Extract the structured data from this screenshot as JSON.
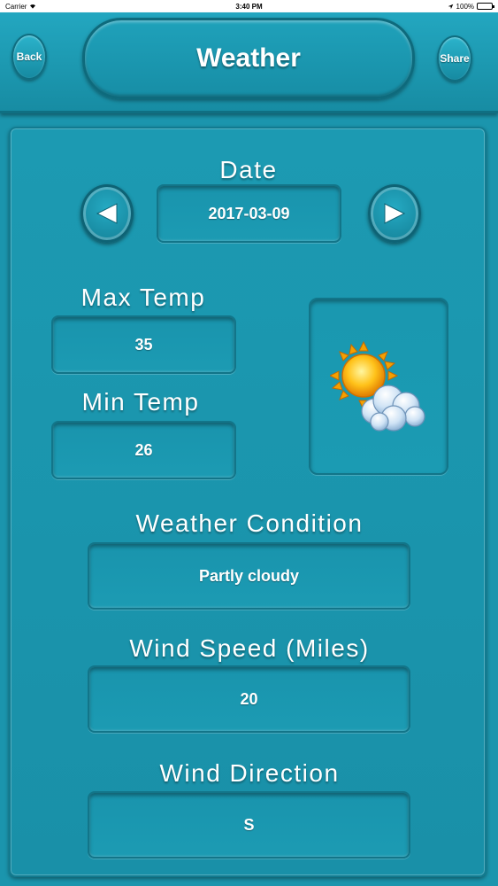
{
  "status_bar": {
    "carrier": "Carrier",
    "time": "3:40 PM",
    "battery": "100%"
  },
  "header": {
    "back_label": "Back",
    "title": "Weather",
    "share_label": "Share"
  },
  "date": {
    "label": "Date",
    "value": "2017-03-09"
  },
  "max_temp": {
    "label": "Max Temp",
    "value": "35"
  },
  "min_temp": {
    "label": "Min Temp",
    "value": "26"
  },
  "weather_condition": {
    "label": "Weather Condition",
    "value": "Partly cloudy",
    "icon": "partly-cloudy-icon"
  },
  "wind_speed": {
    "label": "Wind Speed (Miles)",
    "value": "20"
  },
  "wind_direction": {
    "label": "Wind Direction",
    "value": "S"
  },
  "colors": {
    "background": "#1b95ad",
    "border_dark": "#127589",
    "text": "#ffffff"
  }
}
